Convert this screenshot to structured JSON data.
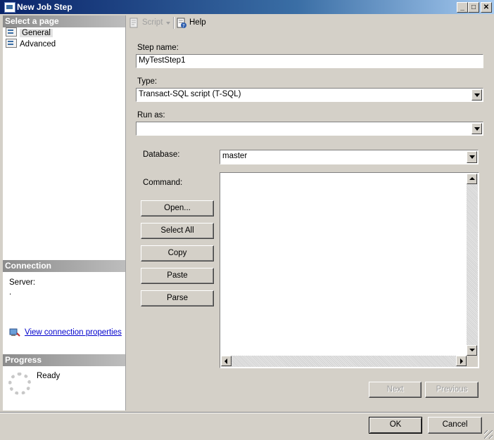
{
  "window": {
    "title": "New Job Step"
  },
  "left": {
    "select_page_header": "Select a page",
    "pages": [
      {
        "label": "General"
      },
      {
        "label": "Advanced"
      }
    ],
    "connection_header": "Connection",
    "server_label": "Server:",
    "server_value": ".",
    "view_connection_link": "View connection properties",
    "progress_header": "Progress",
    "progress_status": "Ready"
  },
  "toolbar": {
    "script_label": "Script",
    "help_label": "Help"
  },
  "form": {
    "step_name_label": "Step name:",
    "step_name_value": "MyTestStep1",
    "type_label": "Type:",
    "type_value": "Transact-SQL script (T-SQL)",
    "run_as_label": "Run as:",
    "run_as_value": "",
    "database_label": "Database:",
    "database_value": "master",
    "command_label": "Command:",
    "command_value": ""
  },
  "command_buttons": {
    "open": "Open...",
    "select_all": "Select All",
    "copy": "Copy",
    "paste": "Paste",
    "parse": "Parse"
  },
  "nav_buttons": {
    "next": "Next",
    "previous": "Previous"
  },
  "dialog_buttons": {
    "ok": "OK",
    "cancel": "Cancel"
  },
  "icons": {
    "window": "sql-agent-icon",
    "script": "script-icon",
    "help": "help-icon",
    "page": "page-icon",
    "connection": "connection-icon",
    "progress": "progress-spinner-icon"
  }
}
